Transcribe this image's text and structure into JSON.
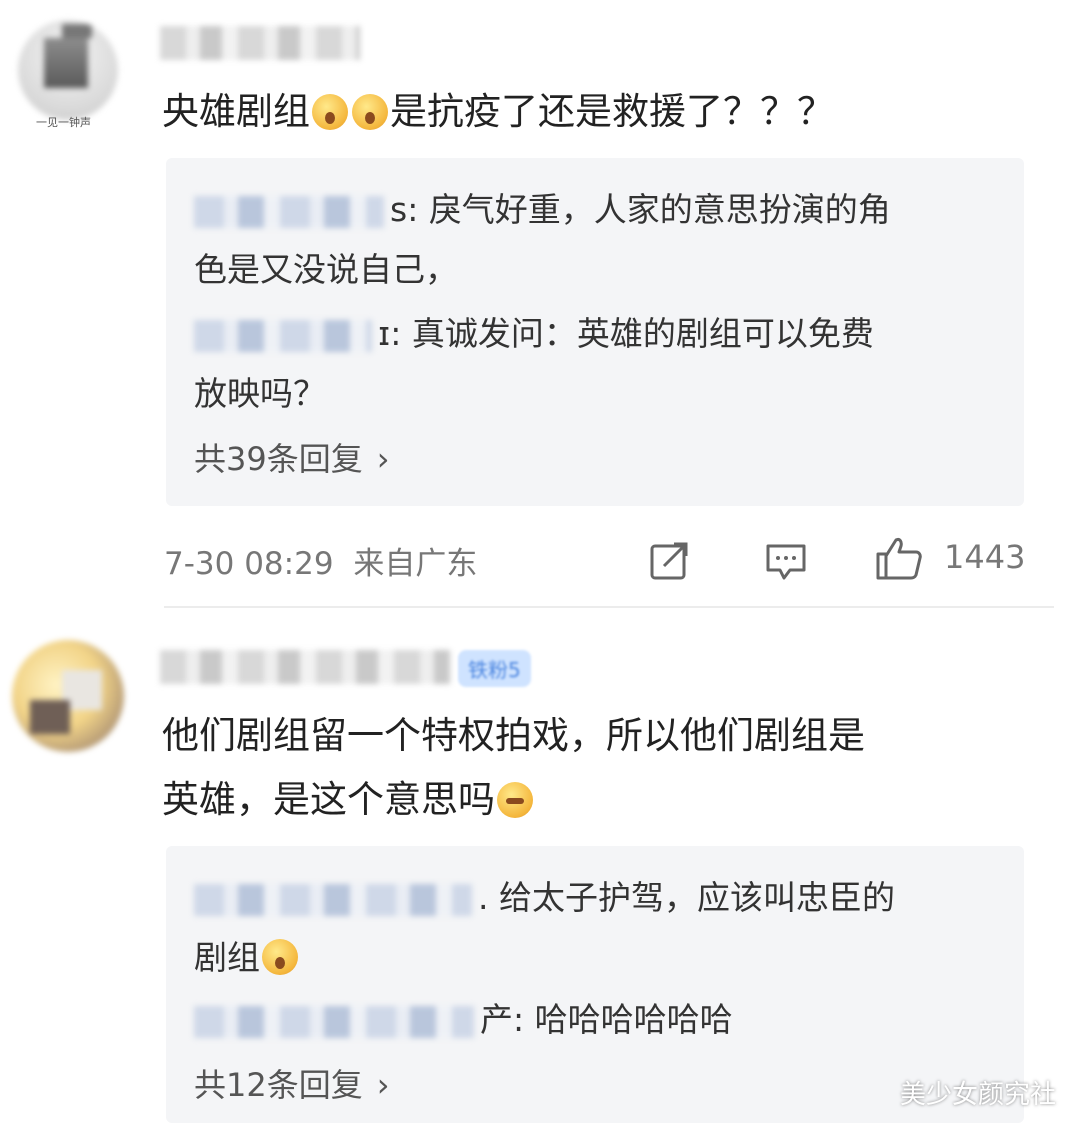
{
  "comment1": {
    "avatar_caption": "一见一钟声",
    "text_before_emoji": "央雄剧组",
    "text_after_emoji": "是抗疫了还是救援了？？？",
    "replies": [
      {
        "suffix": "s:",
        "text_line1": " 戾气好重，人家的意思扮演的角",
        "text_line2": "色是又没说自己，"
      },
      {
        "suffix": "ɪ:",
        "text_line1": " 真诚发问：英雄的剧组可以免费",
        "text_line2": "放映吗？"
      }
    ],
    "more_replies": "共39条回复",
    "chevron": "›",
    "timestamp": "7-30 08:29",
    "location": "来自广东",
    "like_count": "1443"
  },
  "comment2": {
    "badge": "铁粉5",
    "text_line1": "他们剧组留一个特权拍戏，所以他们剧组是",
    "text_line2": "英雄，是这个意思吗",
    "replies": [
      {
        "suffix": ".",
        "text_line1": " 给太子护驾，应该叫忠臣的",
        "text_line2": "剧组"
      },
      {
        "suffix": "产:",
        "text_line1": " 哈哈哈哈哈哈",
        "text_line2": ""
      }
    ],
    "more_replies": "共12条回复",
    "chevron": "›"
  },
  "watermark": "美少女颜究社",
  "icons": [
    "share-icon",
    "comment-icon",
    "like-icon",
    "emoji-surprised-icon",
    "emoji-wink-icon",
    "emoji-cry-icon",
    "chevron-right-icon"
  ]
}
